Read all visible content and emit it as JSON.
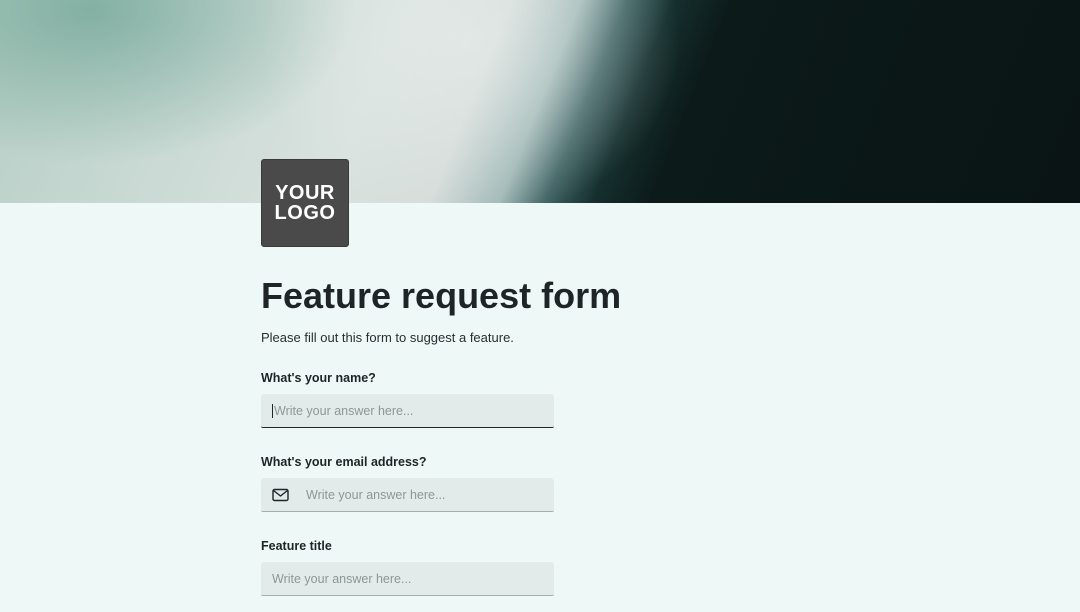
{
  "logo": {
    "text": "YOUR\nLOGO"
  },
  "form": {
    "title": "Feature request form",
    "description": "Please fill out this form to suggest a feature.",
    "fields": [
      {
        "label": "What's your name?",
        "placeholder": "Write your answer here...",
        "value": "",
        "icon": null,
        "focused": true
      },
      {
        "label": "What's your email address?",
        "placeholder": "Write your answer here...",
        "value": "",
        "icon": "mail-icon",
        "focused": false
      },
      {
        "label": "Feature title",
        "placeholder": "Write your answer here...",
        "value": "",
        "icon": null,
        "focused": false
      }
    ]
  },
  "colors": {
    "page_background": "#eef8f6",
    "input_background": "#e2ebe9",
    "logo_background": "#4a4a4a",
    "text": "#1f2426"
  }
}
